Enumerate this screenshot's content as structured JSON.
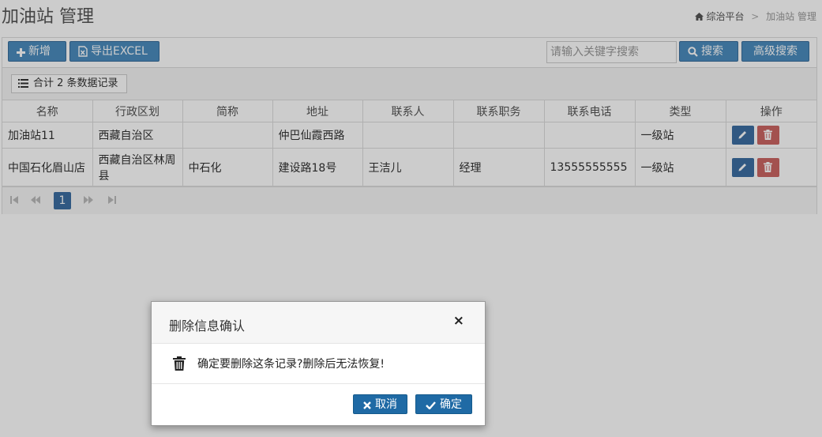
{
  "page": {
    "title": "加油站 管理"
  },
  "breadcrumb": {
    "home": "综治平台",
    "separator": ">",
    "current": "加油站 管理"
  },
  "toolbar": {
    "add_label": "新增",
    "export_label": "导出EXCEL",
    "search_placeholder": "请输入关键字搜索",
    "search_value": "",
    "search_label": "搜索",
    "advanced_label": "高级搜索"
  },
  "summary": {
    "text": "合计 2 条数据记录"
  },
  "table": {
    "columns": [
      "名称",
      "行政区划",
      "简称",
      "地址",
      "联系人",
      "联系职务",
      "联系电话",
      "类型",
      "操作"
    ],
    "rows": [
      [
        "加油站11",
        "西藏自治区",
        "",
        "仲巴仙霞西路",
        "",
        "",
        "",
        "一级站"
      ],
      [
        "中国石化眉山店",
        "西藏自治区林周县",
        "中石化",
        "建设路18号",
        "王洁儿",
        "经理",
        "13555555555",
        "一级站"
      ]
    ]
  },
  "pager": {
    "current_page": "1"
  },
  "modal": {
    "title": "删除信息确认",
    "close_symbol": "×",
    "message": "确定要删除这条记录?删除后无法恢复!",
    "cancel_label": "取消",
    "confirm_label": "确定"
  },
  "icons": {
    "home": "home-icon",
    "add": "plus-icon",
    "export": "excel-file-icon",
    "search": "search-icon",
    "list": "list-icon",
    "edit": "pencil-icon",
    "delete": "trash-icon",
    "first": "first-page-icon",
    "prev": "prev-page-icon",
    "next": "next-page-icon",
    "last": "last-page-icon",
    "close": "close-icon",
    "cancel": "times-icon",
    "confirm": "check-icon",
    "message": "trash-icon"
  },
  "colors": {
    "primary": "#4c8cbe",
    "dark_primary": "#1f6aa5",
    "danger": "#cc6663",
    "edit": "#3d6fa3"
  }
}
